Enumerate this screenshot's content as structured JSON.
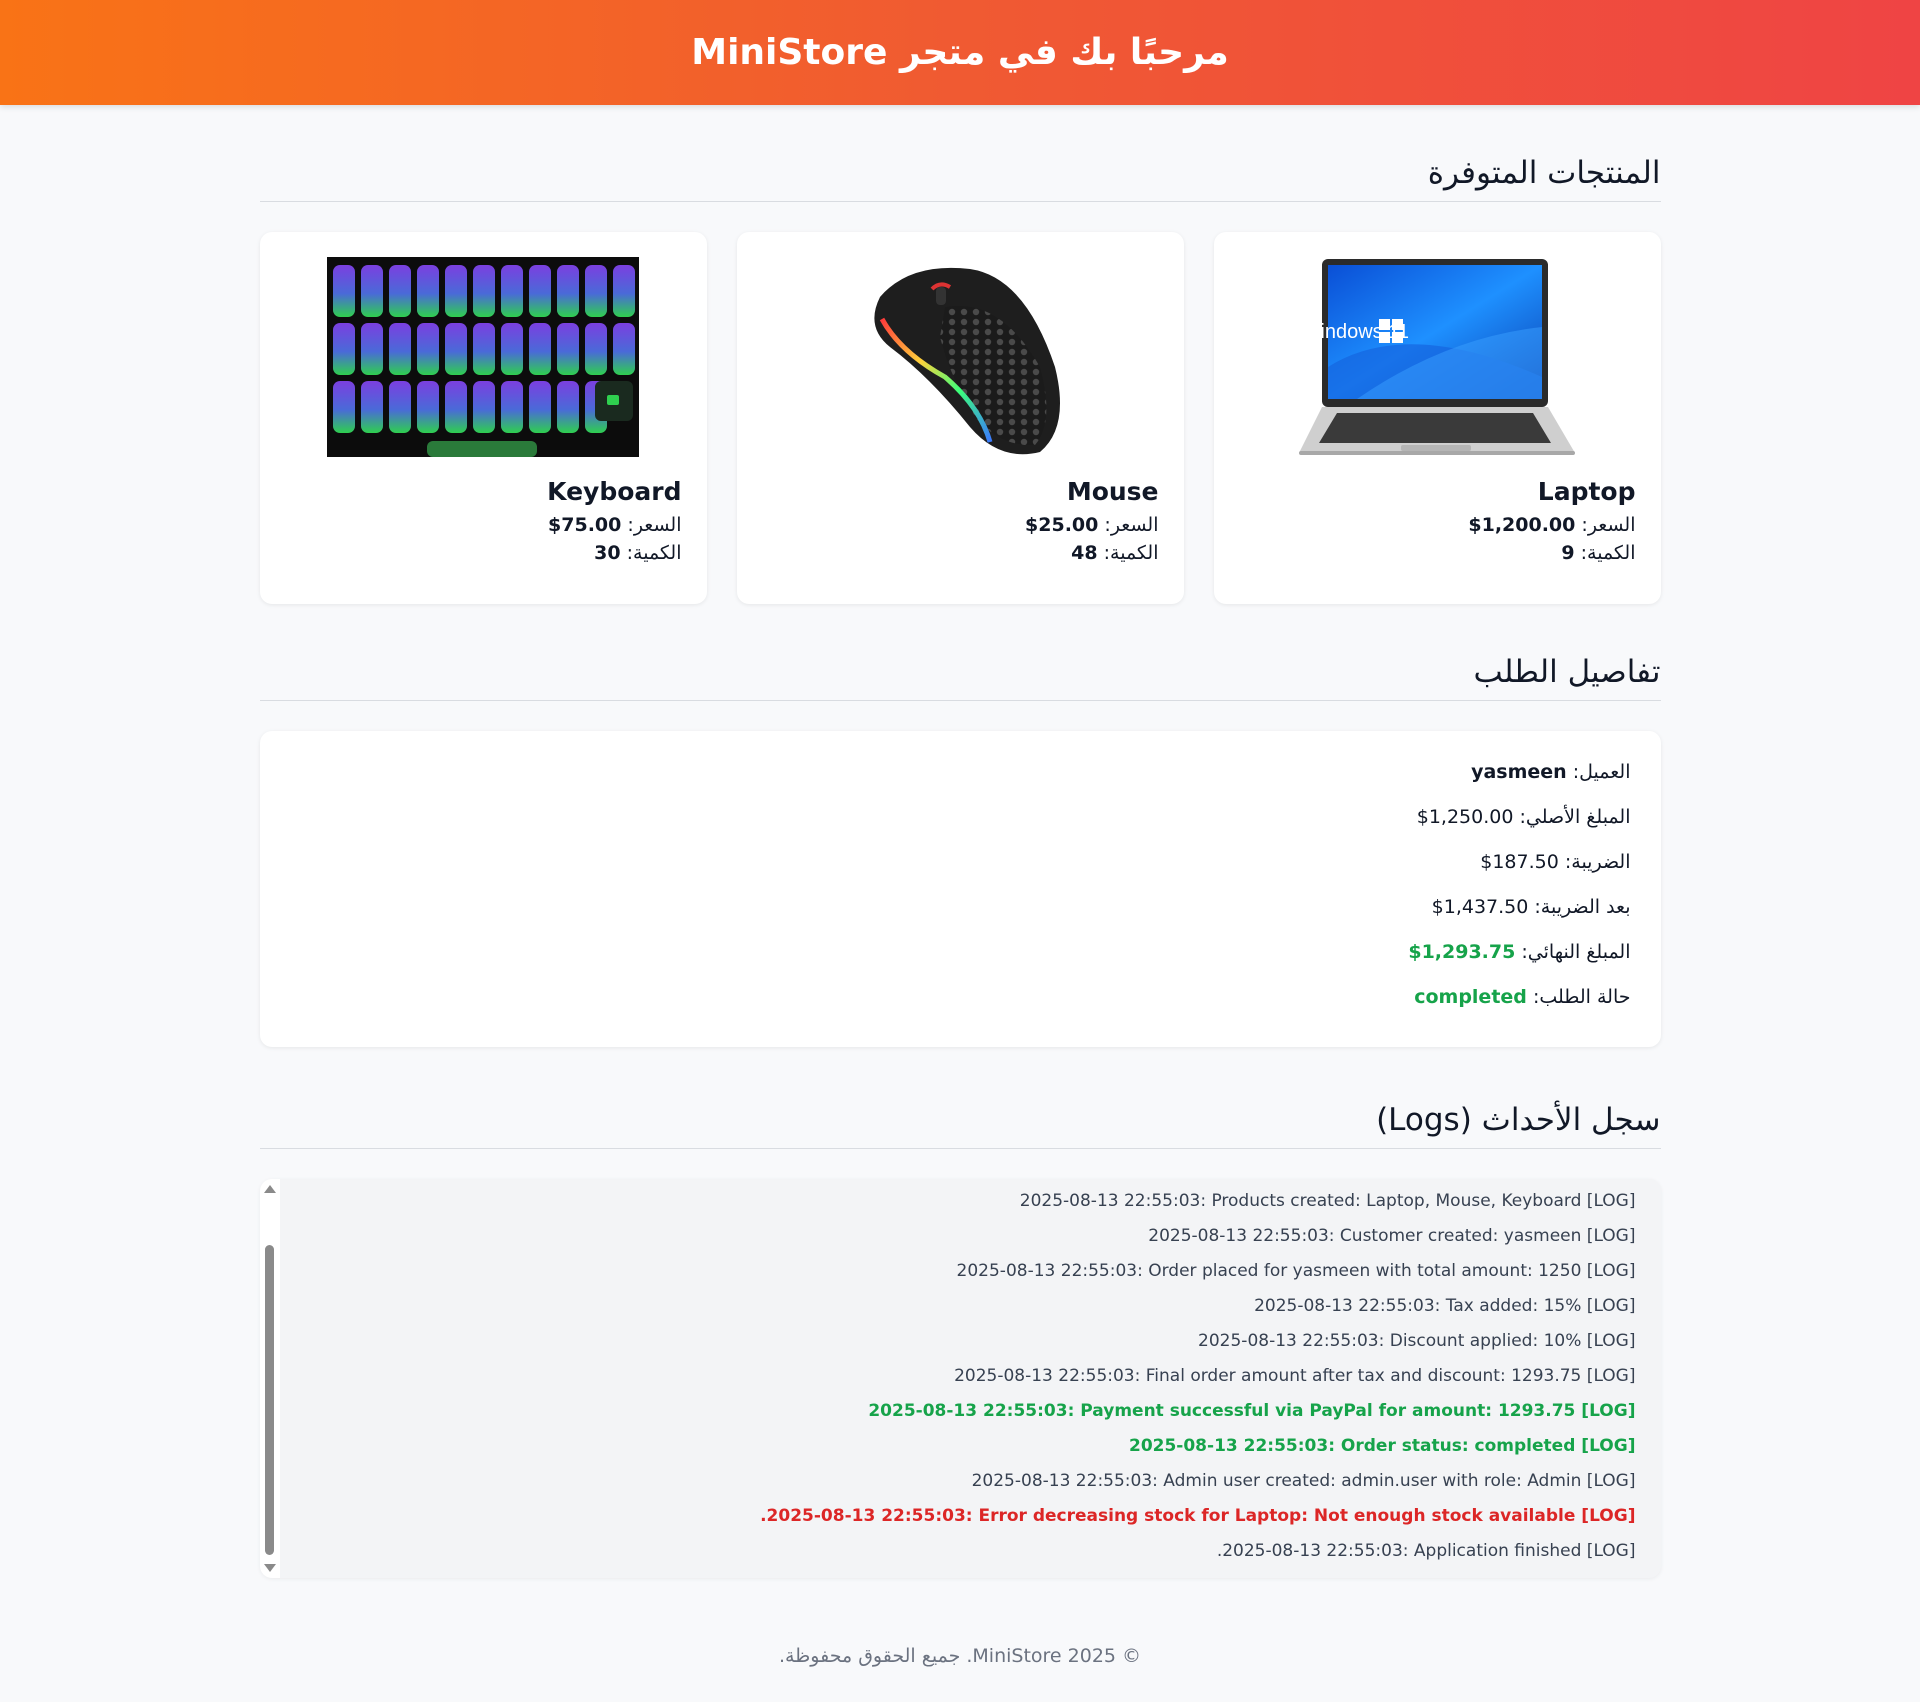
{
  "header": {
    "title": "مرحبًا بك في متجر MiniStore"
  },
  "products_section": {
    "title": "المنتجات المتوفرة"
  },
  "products": [
    {
      "name": "Laptop",
      "price_label": "السعر:",
      "price": "$1,200.00",
      "qty_label": "الكمية:",
      "qty": "9",
      "image": "laptop-image"
    },
    {
      "name": "Mouse",
      "price_label": "السعر:",
      "price": "$25.00",
      "qty_label": "الكمية:",
      "qty": "48",
      "image": "mouse-image"
    },
    {
      "name": "Keyboard",
      "price_label": "السعر:",
      "price": "$75.00",
      "qty_label": "الكمية:",
      "qty": "30",
      "image": "keyboard-image"
    }
  ],
  "order_section": {
    "title": "تفاصيل الطلب"
  },
  "order": {
    "customer_label": "العميل:",
    "customer": "yasmeen",
    "original_label": "المبلغ الأصلي:",
    "original": "$1,250.00",
    "tax_label": "الضريبة:",
    "tax": "$187.50",
    "after_tax_label": "بعد الضريبة:",
    "after_tax": "$1,437.50",
    "final_label": "المبلغ النهائي:",
    "final": "$1,293.75",
    "status_label": "حالة الطلب:",
    "status": "completed"
  },
  "logs_section": {
    "title": "سجل الأحداث (Logs)"
  },
  "logs": [
    {
      "text": "[LOG] 2025-08-13 22:55:03: Products created: Laptop, Mouse, Keyboard",
      "type": "info"
    },
    {
      "text": "[LOG] 2025-08-13 22:55:03: Customer created: yasmeen",
      "type": "info"
    },
    {
      "text": "[LOG] 2025-08-13 22:55:03: Order placed for yasmeen with total amount: 1250",
      "type": "info"
    },
    {
      "text": "[LOG] 2025-08-13 22:55:03: Tax added: 15%",
      "type": "info"
    },
    {
      "text": "[LOG] 2025-08-13 22:55:03: Discount applied: 10%",
      "type": "info"
    },
    {
      "text": "[LOG] 2025-08-13 22:55:03: Final order amount after tax and discount: 1293.75",
      "type": "info"
    },
    {
      "text": "[LOG] 2025-08-13 22:55:03: Payment successful via PayPal for amount: 1293.75",
      "type": "success"
    },
    {
      "text": "[LOG] 2025-08-13 22:55:03: Order status: completed",
      "type": "success"
    },
    {
      "text": "[LOG] 2025-08-13 22:55:03: Admin user created: admin.user with role: Admin",
      "type": "info"
    },
    {
      "text": "[LOG] 2025-08-13 22:55:03: Error decreasing stock for Laptop: Not enough stock available.",
      "type": "error"
    },
    {
      "text": "[LOG] 2025-08-13 22:55:03: Application finished.",
      "type": "info"
    }
  ],
  "footer": {
    "text": "© 2025 MiniStore. جميع الحقوق محفوظة."
  },
  "colors": {
    "header_start": "#f97316",
    "header_end": "#ef4444",
    "success": "#16a34a",
    "error": "#dc2626"
  }
}
